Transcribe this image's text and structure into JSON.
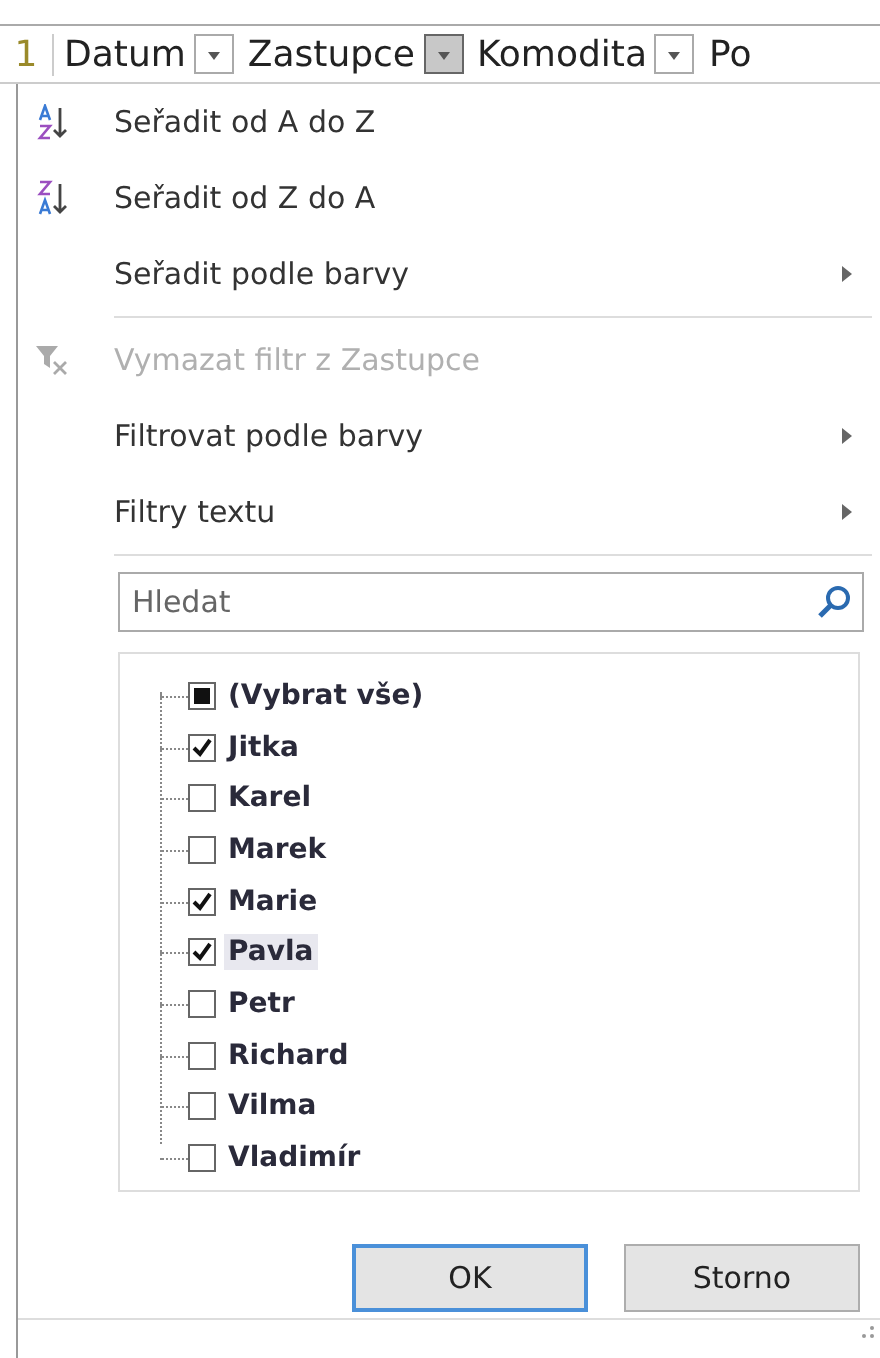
{
  "header": {
    "row_number": "1",
    "columns": [
      {
        "label": "Datum",
        "filter_button": true,
        "active": false
      },
      {
        "label": "Zastupce",
        "filter_button": true,
        "active": true
      },
      {
        "label": "Komodita",
        "filter_button": true,
        "active": false
      },
      {
        "label": "Po",
        "filter_button": false
      }
    ]
  },
  "menu_sections": [
    [
      {
        "label": "Seřadit od A do Z",
        "kind": "ascending",
        "disabled": false,
        "submenu": false
      },
      {
        "label": "Seřadit od Z do A",
        "kind": "descending",
        "disabled": false,
        "submenu": false
      },
      {
        "label": "Seřadit podle barvy",
        "kind": "plain",
        "disabled": false,
        "submenu": true
      }
    ],
    [
      {
        "label": "Vymazat filtr z Zastupce",
        "kind": "clear",
        "disabled": true,
        "submenu": false
      },
      {
        "label": "Filtrovat podle barvy",
        "kind": "plain",
        "disabled": false,
        "submenu": true
      },
      {
        "label": "Filtry textu",
        "kind": "plain",
        "disabled": false,
        "submenu": true
      }
    ]
  ],
  "search": {
    "placeholder": "Hledat"
  },
  "values": [
    {
      "label": "(Vybrat vše)",
      "kind": "select-all",
      "checked": false,
      "partial": true,
      "hovered": false
    },
    {
      "label": "Jitka",
      "kind": "value",
      "checked": true,
      "hovered": false
    },
    {
      "label": "Karel",
      "kind": "value",
      "checked": false,
      "hovered": false
    },
    {
      "label": "Marek",
      "kind": "value",
      "checked": false,
      "hovered": false
    },
    {
      "label": "Marie",
      "kind": "value",
      "checked": true,
      "hovered": false
    },
    {
      "label": "Pavla",
      "kind": "value",
      "checked": true,
      "hovered": true
    },
    {
      "label": "Petr",
      "kind": "value",
      "checked": false,
      "hovered": false
    },
    {
      "label": "Richard",
      "kind": "value",
      "checked": false,
      "hovered": false
    },
    {
      "label": "Vilma",
      "kind": "value",
      "checked": false,
      "hovered": false
    },
    {
      "label": "Vladimír",
      "kind": "value",
      "checked": false,
      "hovered": false
    }
  ],
  "buttons": [
    {
      "label": "OK",
      "default": true
    },
    {
      "label": "Storno",
      "default": false
    }
  ]
}
